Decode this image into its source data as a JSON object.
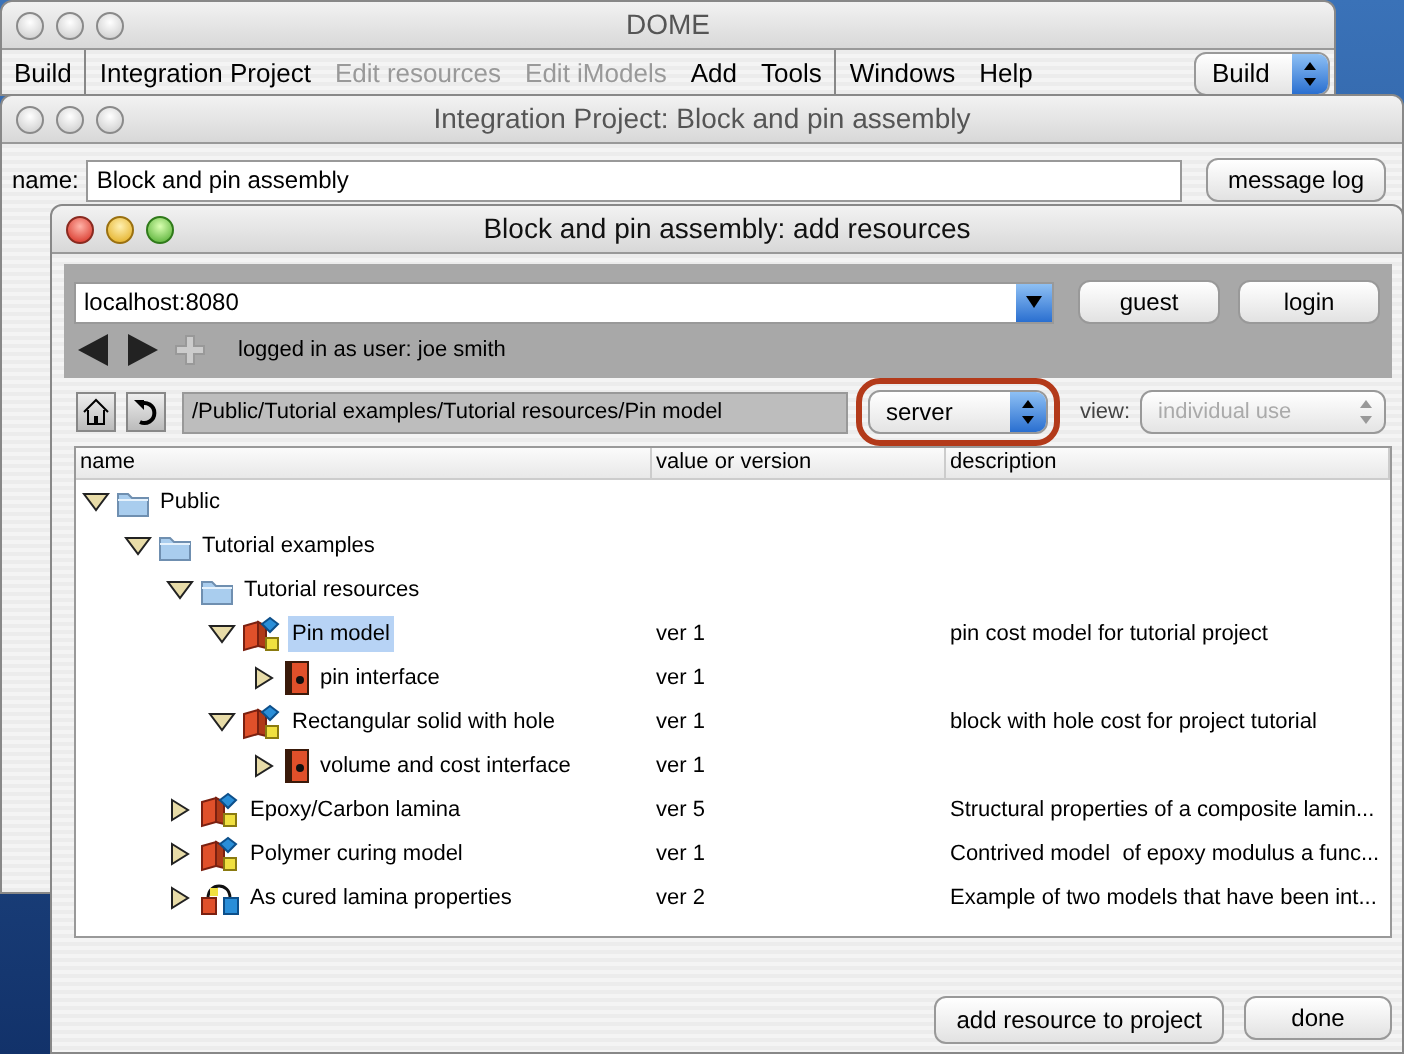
{
  "main_window": {
    "title": "DOME",
    "menu": [
      {
        "label": "Build",
        "disabled": false,
        "divider_after": true
      },
      {
        "label": "Integration Project",
        "disabled": false,
        "divider_after": false
      },
      {
        "label": "Edit resources",
        "disabled": true,
        "divider_after": false
      },
      {
        "label": "Edit iModels",
        "disabled": true,
        "divider_after": false
      },
      {
        "label": "Add",
        "disabled": false,
        "divider_after": false
      },
      {
        "label": "Tools",
        "disabled": false,
        "divider_after": true
      },
      {
        "label": "Windows",
        "disabled": false,
        "divider_after": false
      },
      {
        "label": "Help",
        "disabled": false,
        "divider_after": false
      }
    ],
    "mode_select": "Build"
  },
  "project_window": {
    "title": "Integration Project: Block and pin assembly",
    "name_label": "name:",
    "name_value": "Block and pin assembly",
    "message_log_button": "message log"
  },
  "dialog": {
    "title": "Block and pin assembly: add resources",
    "server_field": "localhost:8080",
    "guest_button": "guest",
    "login_button": "login",
    "login_status": "logged in as user: joe smith",
    "path": "/Public/Tutorial examples/Tutorial resources/Pin  model",
    "location_select": "server",
    "location_highlighted": true,
    "view_label": "view:",
    "view_select": "individual use",
    "view_disabled": true,
    "tree": {
      "columns": [
        "name",
        "value or version",
        "description"
      ],
      "items": [
        {
          "name": "Public",
          "kind": "folder",
          "expanded": true,
          "selected": false,
          "children": [
            {
              "name": "Tutorial examples",
              "kind": "folder",
              "expanded": true,
              "selected": false,
              "children": [
                {
                  "name": "Tutorial resources",
                  "kind": "folder",
                  "expanded": true,
                  "selected": false,
                  "children": [
                    {
                      "name": "Pin  model",
                      "kind": "model",
                      "version": "ver 1",
                      "description": "pin cost model for tutorial project",
                      "expanded": true,
                      "selected": true,
                      "children": [
                        {
                          "name": "pin interface",
                          "kind": "interface",
                          "version": "ver 1",
                          "expanded": false,
                          "selected": false
                        }
                      ]
                    },
                    {
                      "name": "Rectangular solid with hole",
                      "kind": "model",
                      "version": "ver 1",
                      "description": "block with hole cost for project tutorial",
                      "expanded": true,
                      "selected": false,
                      "children": [
                        {
                          "name": "volume and cost interface",
                          "kind": "interface",
                          "version": "ver 1",
                          "expanded": false,
                          "selected": false
                        }
                      ]
                    }
                  ]
                },
                {
                  "name": "Epoxy/Carbon lamina",
                  "kind": "model",
                  "version": "ver 5",
                  "description": "Structural properties of a composite lamin...",
                  "expanded": false,
                  "selected": false
                },
                {
                  "name": "Polymer curing model",
                  "kind": "model",
                  "version": "ver 1",
                  "description": "Contrived model  of epoxy modulus a func...",
                  "expanded": false,
                  "selected": false
                },
                {
                  "name": "As cured lamina properties",
                  "kind": "project",
                  "version": "ver 2",
                  "description": "Example of two models that have been int...",
                  "expanded": false,
                  "selected": false
                }
              ]
            }
          ]
        }
      ]
    },
    "add_button": "add resource to project",
    "done_button": "done"
  }
}
